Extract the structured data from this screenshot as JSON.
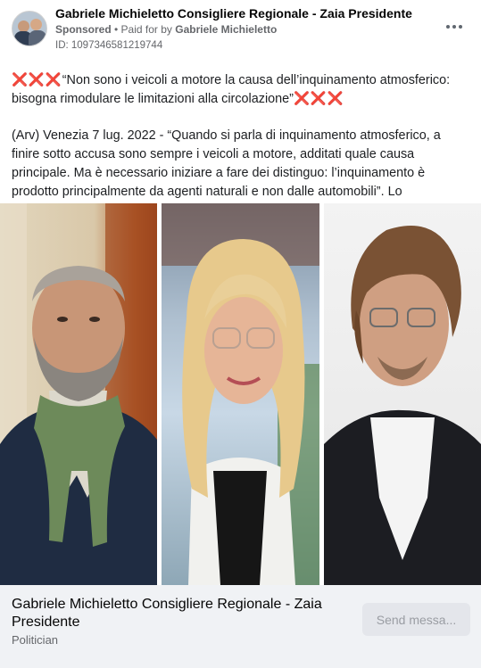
{
  "header": {
    "page_name": "Gabriele Michieletto Consigliere Regionale - Zaia Presidente",
    "sponsored": "Sponsored",
    "separator": " • ",
    "paid_for_prefix": "Paid for by ",
    "paid_for_name": "Gabriele Michieletto",
    "ad_id": "ID: 1097346581219744"
  },
  "post": {
    "headline_prefix": "❌❌❌",
    "headline": "“Non sono i veicoli a motore la causa dell’inquinamento atmosferico: bisogna rimodulare le limitazioni alla circolazione”",
    "headline_suffix": "❌❌❌",
    "body": "(Arv) Venezia 7 lug. 2022 - “Quando si parla di inquinamento atmosferico, a finire sotto accusa sono sempre i veicoli a motore, additati quale causa principale. Ma è necessario iniziare a fare dei distinguo: l’inquinamento è prodotto principalmente da agenti naturali e non dalle automobili”. Lo sostengono i Consiglieri…"
  },
  "footer": {
    "title": "Gabriele Michieletto Consigliere Regionale - Zaia Presidente",
    "category": "Politician",
    "send_button": "Send messa..."
  },
  "colors": {
    "cross": "#ee6e88",
    "footer_bg": "#f0f2f5",
    "button_bg": "#e4e6eb",
    "muted_text": "#65676b"
  },
  "icons": [
    "more-options-icon",
    "cross-mark-icon"
  ]
}
